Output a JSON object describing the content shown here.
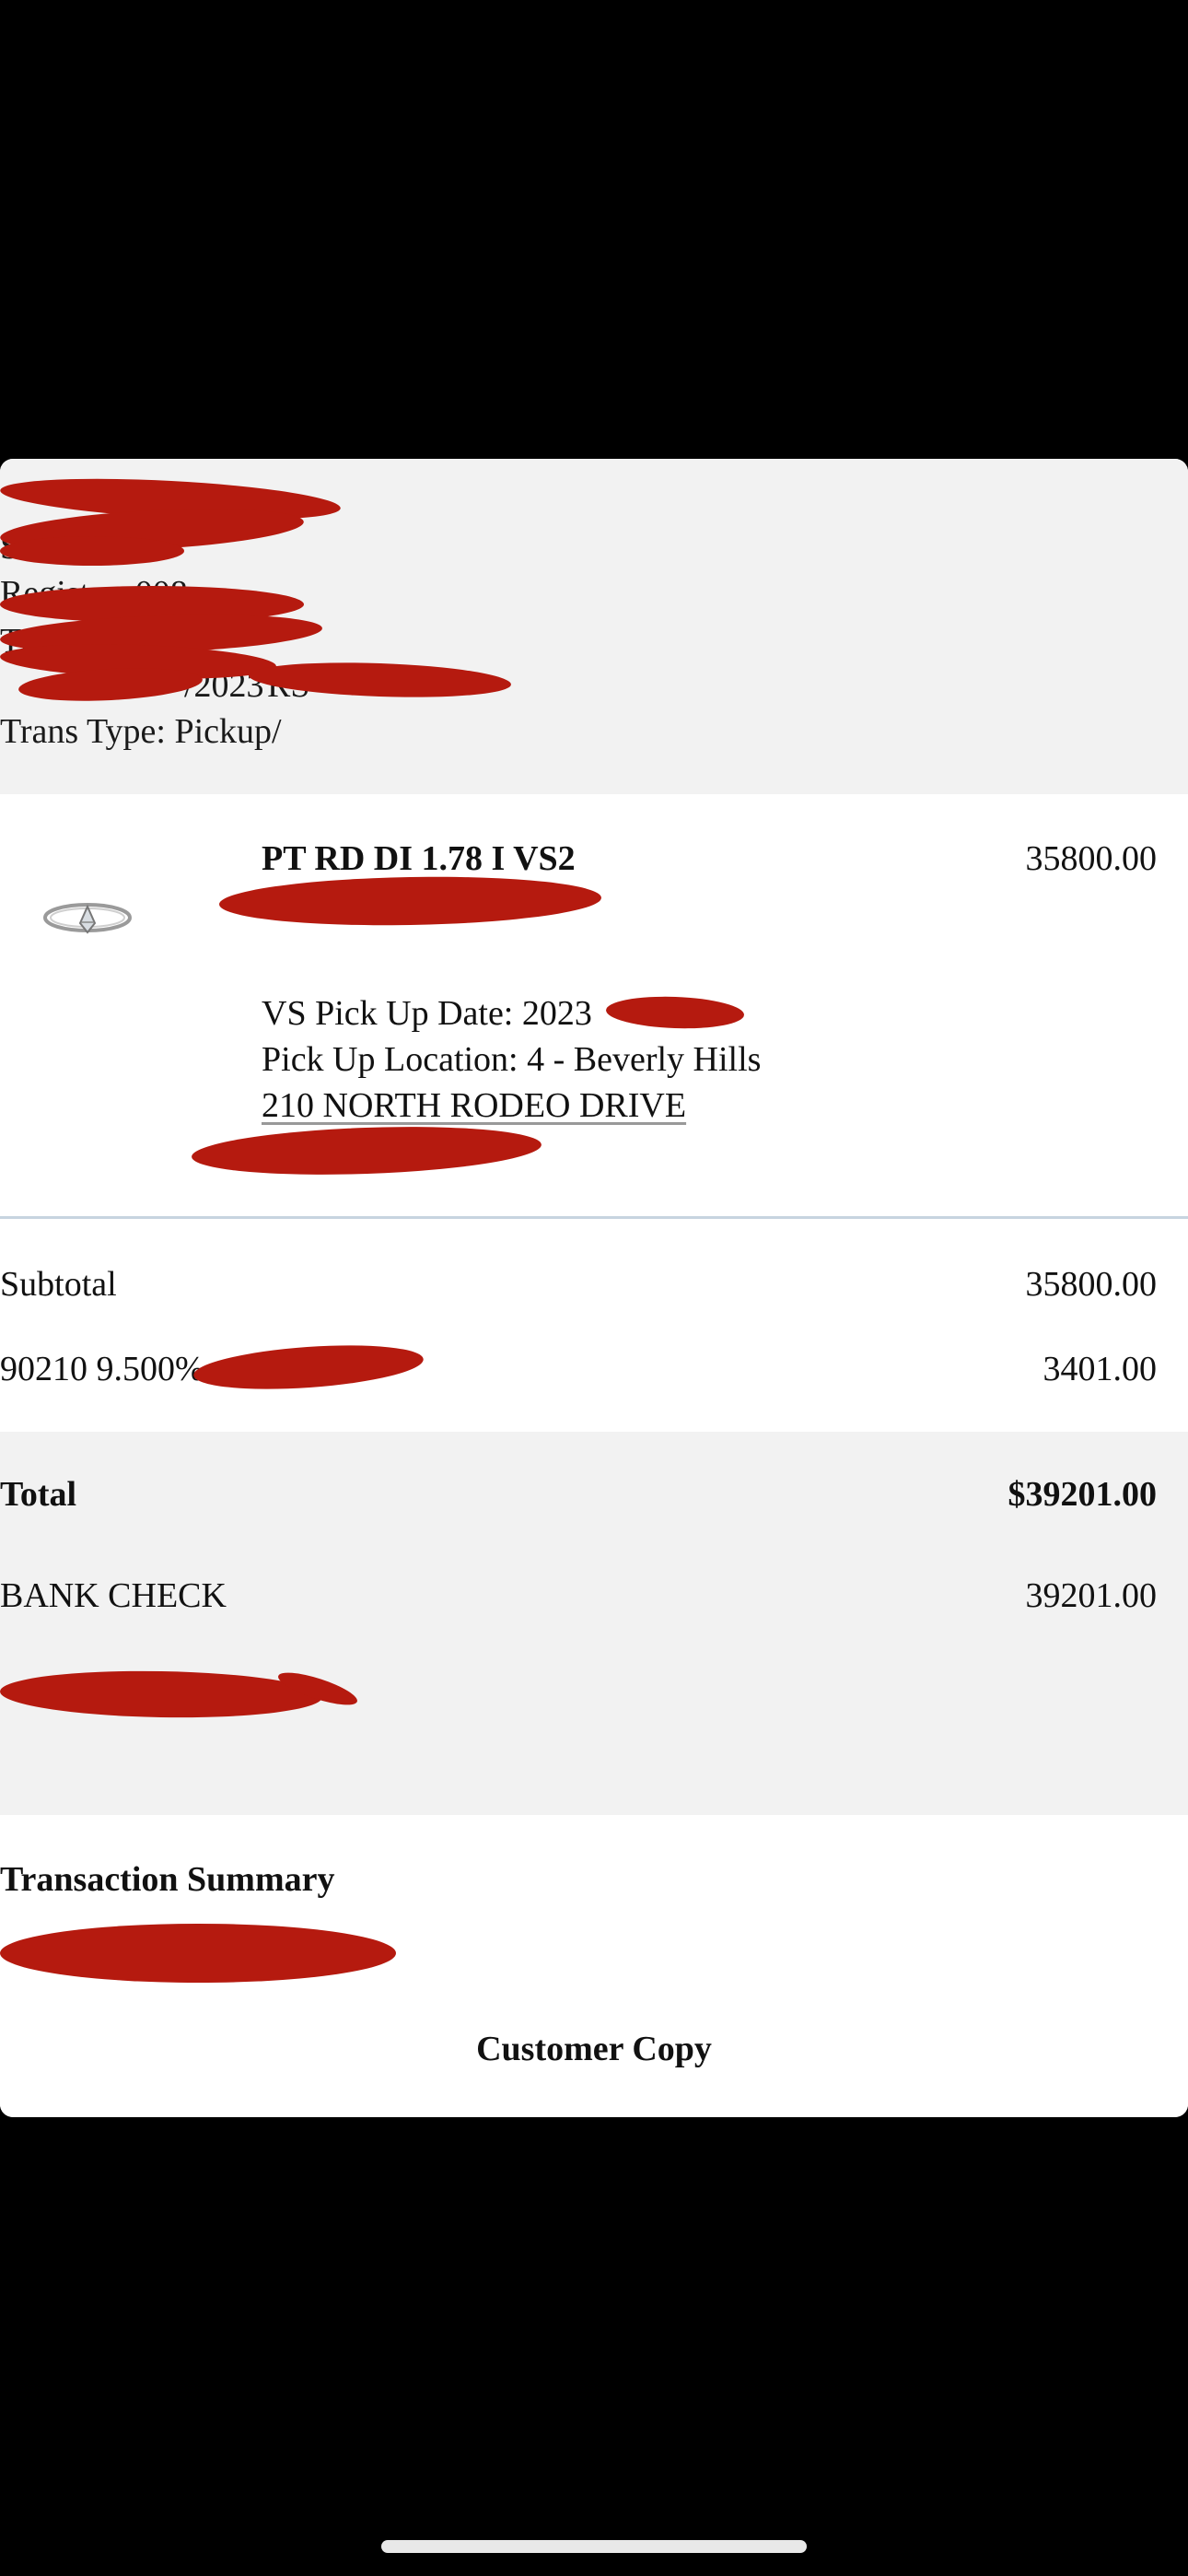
{
  "header": {
    "store_frag": "Store:",
    "register_frag": "Register: 008",
    "trans_frag": "Tra",
    "date_frag": "/2023",
    "rsa_frag": "RS",
    "trans_type": "Trans Type: Pickup/"
  },
  "item": {
    "title": "PT RD DI 1.78 I VS2",
    "price": "35800.00",
    "pickup_date": "VS Pick Up Date: 2023",
    "pickup_location": "Pick Up Location: 4 - Beverly Hills",
    "address": "210 NORTH RODEO DRIVE"
  },
  "subtotal": {
    "label": "Subtotal",
    "value": "35800.00"
  },
  "tax": {
    "label": "90210 9.500%",
    "value": "3401.00"
  },
  "total": {
    "label": "Total",
    "value": "$39201.00"
  },
  "payment": {
    "label": "BANK CHECK",
    "value": "39201.00"
  },
  "summary": {
    "title": "Transaction Summary",
    "footer": "Customer Copy"
  },
  "colors": {
    "redaction": "#b51a0f",
    "header_bg": "#f2f2f2",
    "separator": "#c7d4e0"
  }
}
